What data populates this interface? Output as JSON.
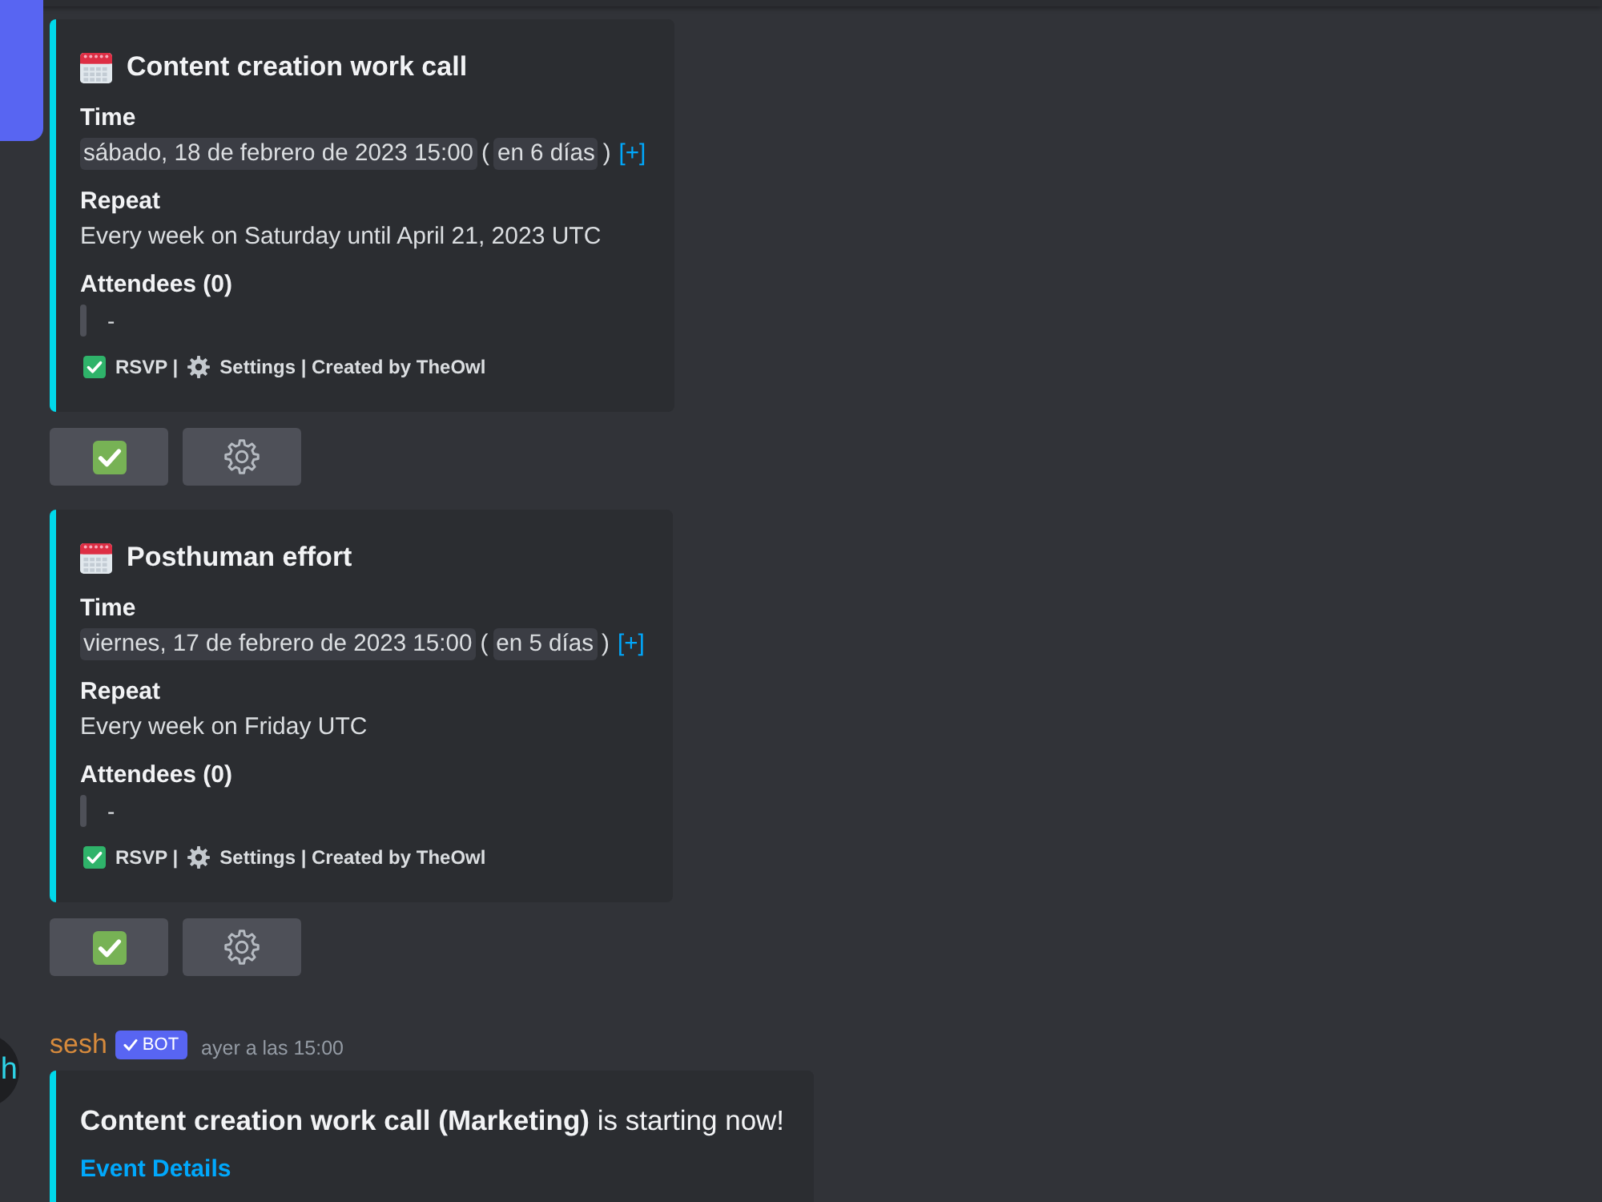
{
  "events": [
    {
      "title": "Content creation work call",
      "fields": [
        {
          "kind": "time",
          "name": "Time",
          "parts": [
            {
              "kind": "chip",
              "text": "sábado, 18 de febrero de 2023 15:00"
            },
            {
              "kind": "plain",
              "text": "("
            },
            {
              "kind": "chip",
              "text": "en 6 días"
            },
            {
              "kind": "plain",
              "text": ")"
            },
            {
              "kind": "link",
              "text": "[+]"
            }
          ]
        },
        {
          "kind": "text",
          "name": "Repeat",
          "value": "Every week on Saturday until April 21, 2023 UTC"
        },
        {
          "kind": "quote",
          "name": "Attendees (0)",
          "value": "-"
        }
      ],
      "footer": [
        {
          "kind": "check",
          "text": "RSVP |"
        },
        {
          "kind": "gear",
          "text": "Settings | Created by TheOwl"
        }
      ],
      "buttons": [
        {
          "kind": "check"
        },
        {
          "kind": "gear"
        }
      ]
    },
    {
      "title": "Posthuman effort",
      "fields": [
        {
          "kind": "time",
          "name": "Time",
          "parts": [
            {
              "kind": "chip",
              "text": "viernes, 17 de febrero de 2023 15:00"
            },
            {
              "kind": "plain",
              "text": "("
            },
            {
              "kind": "chip",
              "text": "en 5 días"
            },
            {
              "kind": "plain",
              "text": ")"
            },
            {
              "kind": "link",
              "text": "[+]"
            }
          ]
        },
        {
          "kind": "text",
          "name": "Repeat",
          "value": "Every week on Friday UTC"
        },
        {
          "kind": "quote",
          "name": "Attendees (0)",
          "value": "-"
        }
      ],
      "footer": [
        {
          "kind": "check",
          "text": "RSVP |"
        },
        {
          "kind": "gear",
          "text": "Settings | Created by TheOwl"
        }
      ],
      "buttons": [
        {
          "kind": "check"
        },
        {
          "kind": "gear"
        }
      ]
    }
  ],
  "message": {
    "avatar_text": "h",
    "author": "sesh",
    "badge": "BOT",
    "time": "ayer a las 15:00",
    "embed": {
      "text": "**Content creation work call (Marketing)** is starting now!",
      "link": "Event Details"
    }
  }
}
